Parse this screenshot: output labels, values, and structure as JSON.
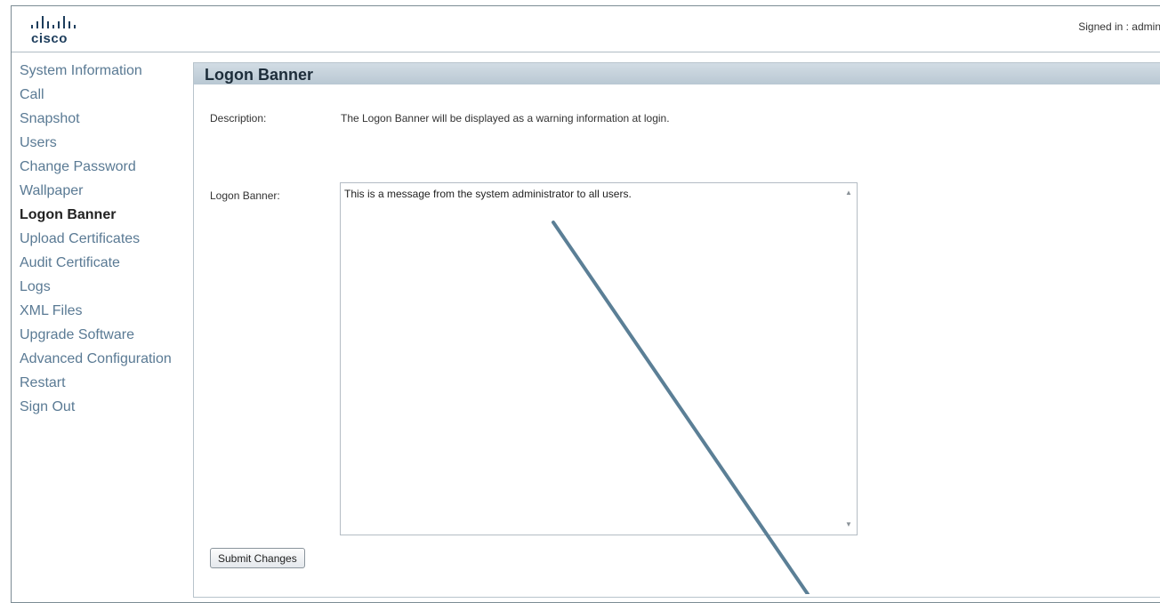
{
  "header": {
    "logo_text": "cisco",
    "signed_in": "Signed in : admin"
  },
  "sidebar": {
    "items": [
      {
        "label": "System Information",
        "active": false
      },
      {
        "label": "Call",
        "active": false
      },
      {
        "label": "Snapshot",
        "active": false
      },
      {
        "label": "Users",
        "active": false
      },
      {
        "label": "Change Password",
        "active": false
      },
      {
        "label": "Wallpaper",
        "active": false
      },
      {
        "label": "Logon Banner",
        "active": true
      },
      {
        "label": "Upload Certificates",
        "active": false
      },
      {
        "label": "Audit Certificate",
        "active": false
      },
      {
        "label": "Logs",
        "active": false
      },
      {
        "label": "XML Files",
        "active": false
      },
      {
        "label": "Upgrade Software",
        "active": false
      },
      {
        "label": "Advanced Configuration",
        "active": false
      },
      {
        "label": "Restart",
        "active": false
      },
      {
        "label": "Sign Out",
        "active": false
      }
    ]
  },
  "main": {
    "title": "Logon Banner",
    "description_label": "Description:",
    "description_text": "The Logon Banner will be displayed as a warning information at login.",
    "banner_label": "Logon Banner:",
    "banner_text": "This is a message from the system administrator to all users.",
    "submit_label": "Submit Changes"
  },
  "colors": {
    "nav_link": "#5a7a94",
    "panel_header": "#c4d0da",
    "annotation_line": "#5b7f96"
  }
}
